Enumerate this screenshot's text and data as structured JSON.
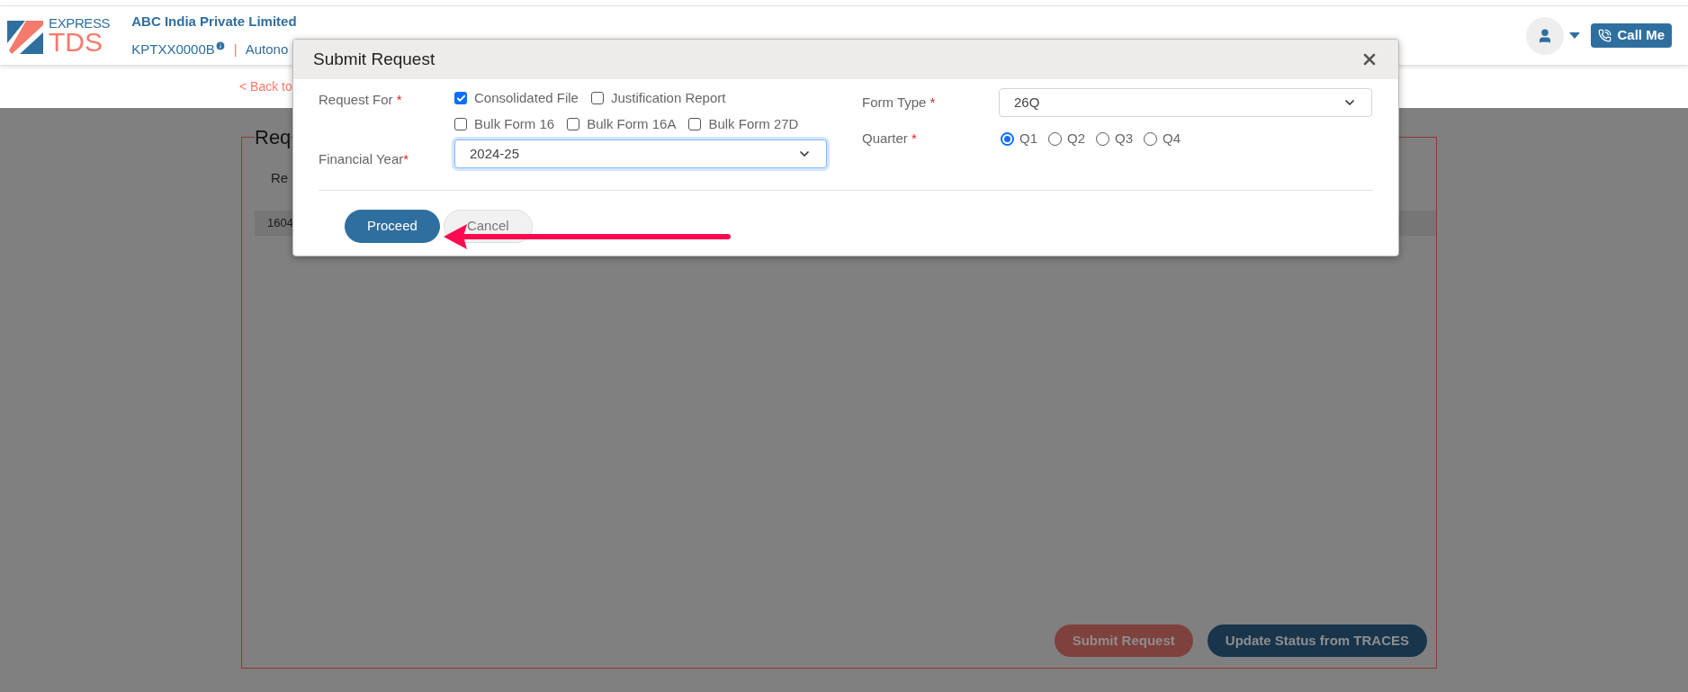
{
  "logo": {
    "line1": "EXPRESS",
    "line2": "TDS"
  },
  "header": {
    "company": "ABC India Private Limited",
    "tan": "KPTXX0000B",
    "separator": "|",
    "module": "Autono",
    "call_button": "Call Me"
  },
  "back_link": "< Back to",
  "background": {
    "legend": "Req",
    "column_label": "Re",
    "row_cell": "1604",
    "buttons": [
      {
        "label": "Submit Request",
        "kind": "danger"
      },
      {
        "label": "Update Status from TRACES",
        "kind": "primary"
      }
    ]
  },
  "modal": {
    "title": "Submit Request",
    "request_for": {
      "label": "Request For",
      "mark": " *",
      "options": [
        {
          "label": "Consolidated File",
          "checked": true
        },
        {
          "label": "Justification Report",
          "checked": false
        },
        {
          "label": "Bulk Form 16",
          "checked": false
        },
        {
          "label": "Bulk Form 16A",
          "checked": false
        },
        {
          "label": "Bulk Form 27D",
          "checked": false
        }
      ]
    },
    "financial_year": {
      "label": "Financial Year",
      "mark": "*",
      "value": "2024-25",
      "focused": true
    },
    "form_type": {
      "label": "Form Type",
      "mark": " *",
      "value": "26Q",
      "focused": false
    },
    "quarter": {
      "label": "Quarter",
      "mark": " *",
      "options": [
        {
          "label": "Q1",
          "selected": true
        },
        {
          "label": "Q2",
          "selected": false
        },
        {
          "label": "Q3",
          "selected": false
        },
        {
          "label": "Q4",
          "selected": false
        }
      ]
    },
    "buttons": [
      {
        "label": "Proceed",
        "kind": "primary"
      },
      {
        "label": "Cancel",
        "kind": "secondary"
      }
    ]
  }
}
